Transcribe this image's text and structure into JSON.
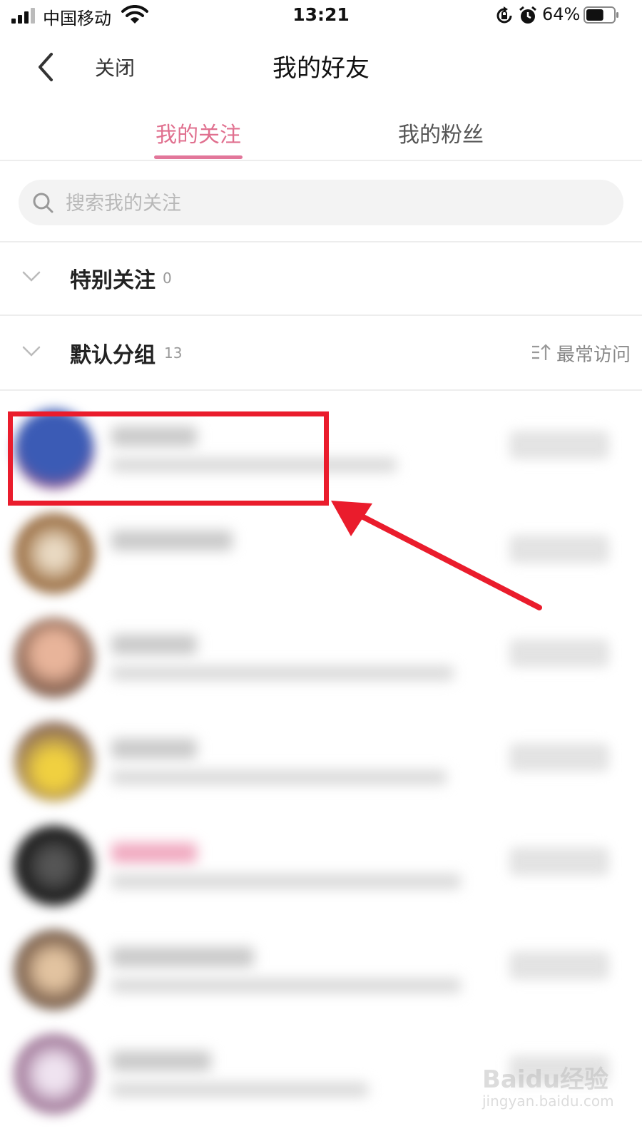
{
  "status_bar": {
    "carrier": "中国移动",
    "time": "13:21",
    "battery": "64%",
    "battery_level": 0.64
  },
  "nav": {
    "close_label": "关闭",
    "title": "我的好友"
  },
  "tabs": [
    {
      "label": "我的关注",
      "active": true
    },
    {
      "label": "我的粉丝",
      "active": false
    }
  ],
  "search": {
    "placeholder": "搜索我的关注"
  },
  "groups": [
    {
      "name": "特别关注",
      "count": "0"
    },
    {
      "name": "默认分组",
      "count": "13",
      "sort_label": "最常访问"
    }
  ],
  "watermark": {
    "logo": "Baidu经验",
    "url": "jingyan.baidu.com"
  },
  "colors": {
    "accent": "#e0708f",
    "annotation": "#ea1c2c"
  }
}
